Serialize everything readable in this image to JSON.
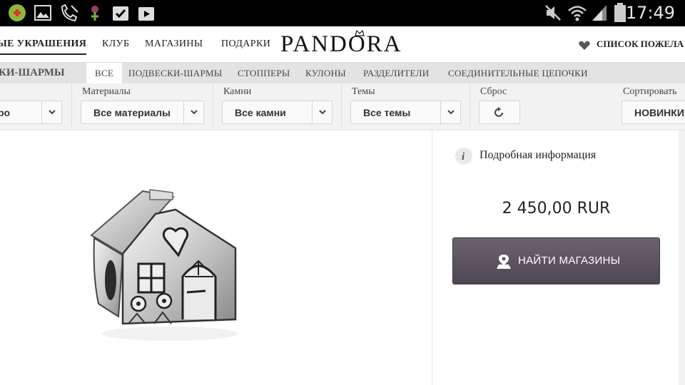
{
  "status_bar": {
    "time": "17:49"
  },
  "nav": {
    "items": [
      "ЫЕ УКРАШЕНИЯ",
      "КЛУБ",
      "МАГАЗИНЫ",
      "ПОДАРКИ"
    ],
    "logo": "PANDORA",
    "wishlist": "СПИСОК ПОЖЕЛА"
  },
  "category": {
    "title": "КИ-ШАРМЫ",
    "tabs": [
      "ВСЕ",
      "ПОДВЕСКИ-ШАРМЫ",
      "СТОППЕРЫ",
      "КУЛОНЫ",
      "РАЗДЕЛИТЕЛИ",
      "СОЕДИНИТЕЛЬНЫЕ ЦЕПОЧКИ"
    ],
    "active_tab": "ВСЕ"
  },
  "filters": {
    "first_value": "ро",
    "materials": {
      "label": "Материалы",
      "value": "Все материалы"
    },
    "stones": {
      "label": "Камни",
      "value": "Все камни"
    },
    "themes": {
      "label": "Темы",
      "value": "Все темы"
    },
    "reset": {
      "label": "Сброс"
    },
    "sort": {
      "label": "Сортировать",
      "value": "НОВИНКИ"
    }
  },
  "product": {
    "info_label": "Подробная информация",
    "price": "2 450,00 RUR",
    "find_button": "НАЙТИ МАГАЗИНЫ",
    "image": "house-charm"
  },
  "colors": {
    "button": "#5c5361",
    "category_bar": "#e3e3e3",
    "filter_bar": "#f2f2f2"
  }
}
